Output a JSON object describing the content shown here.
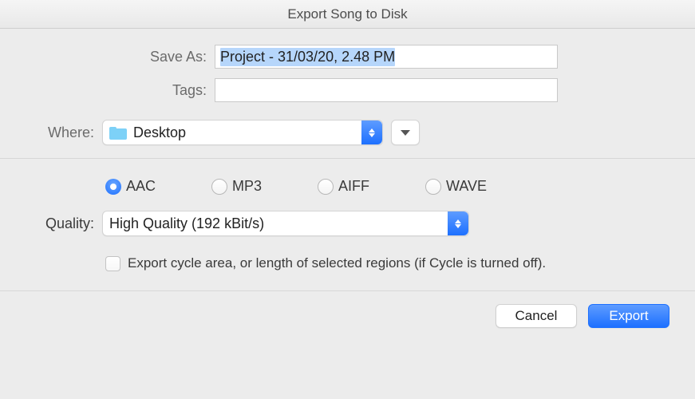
{
  "window": {
    "title": "Export Song to Disk"
  },
  "save_as": {
    "label": "Save As:",
    "value": "Project - 31/03/20, 2.48 PM"
  },
  "tags": {
    "label": "Tags:",
    "value": ""
  },
  "where": {
    "label": "Where:",
    "selected": "Desktop"
  },
  "format": {
    "options": [
      {
        "id": "aac",
        "label": "AAC",
        "selected": true
      },
      {
        "id": "mp3",
        "label": "MP3",
        "selected": false
      },
      {
        "id": "aiff",
        "label": "AIFF",
        "selected": false
      },
      {
        "id": "wave",
        "label": "WAVE",
        "selected": false
      }
    ]
  },
  "quality": {
    "label": "Quality:",
    "selected": "High Quality (192 kBit/s)"
  },
  "cycle": {
    "checked": false,
    "label": "Export cycle area, or length of selected regions (if Cycle is turned off)."
  },
  "buttons": {
    "cancel": "Cancel",
    "export": "Export"
  }
}
